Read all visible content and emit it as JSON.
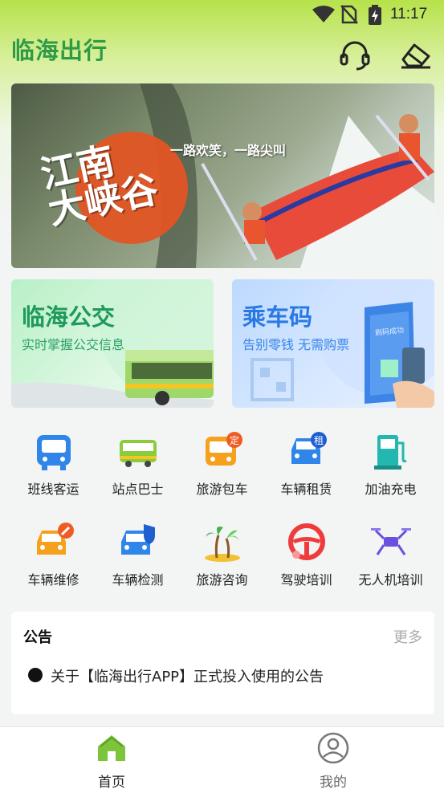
{
  "status_bar": {
    "time": "11:17"
  },
  "header": {
    "app_title": "临海出行"
  },
  "banner": {
    "title_line1": "江南",
    "title_line2": "大峡谷",
    "slogan": "一路欢笑，一路尖叫"
  },
  "cards": [
    {
      "title": "临海公交",
      "subtitle": "实时掌握公交信息"
    },
    {
      "title": "乘车码",
      "subtitle": "告别零钱 无需购票",
      "stamp": "刷码成功"
    }
  ],
  "grid": [
    {
      "label": "班线客运",
      "icon": "bus-front-icon"
    },
    {
      "label": "站点巴士",
      "icon": "bus-side-icon"
    },
    {
      "label": "旅游包车",
      "icon": "charter-bus-icon",
      "badge": "定"
    },
    {
      "label": "车辆租赁",
      "icon": "rental-car-icon",
      "badge": "租"
    },
    {
      "label": "加油充电",
      "icon": "fuel-charge-icon"
    },
    {
      "label": "车辆维修",
      "icon": "car-repair-icon"
    },
    {
      "label": "车辆检测",
      "icon": "car-inspection-icon"
    },
    {
      "label": "旅游咨询",
      "icon": "palm-island-icon"
    },
    {
      "label": "驾驶培训",
      "icon": "steering-wheel-icon"
    },
    {
      "label": "无人机培训",
      "icon": "drone-icon"
    }
  ],
  "notice": {
    "title": "公告",
    "more": "更多",
    "items": [
      "关于【临海出行APP】正式投入使用的公告"
    ]
  },
  "bottom_nav": [
    {
      "label": "首页",
      "active": true
    },
    {
      "label": "我的",
      "active": false
    }
  ],
  "colors": {
    "brand_green": "#2f9a47",
    "bus_card": "#1f9a5c",
    "code_card": "#2a79e3"
  }
}
